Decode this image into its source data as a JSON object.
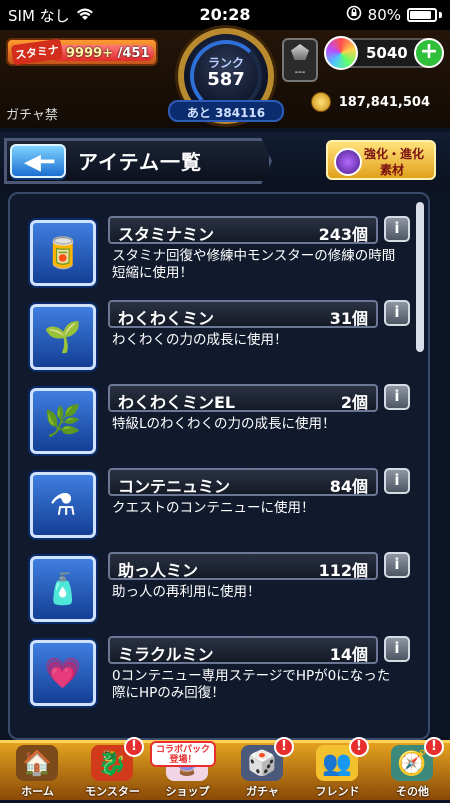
{
  "status": {
    "carrier": "SIM なし",
    "time": "20:28",
    "battery": "80%"
  },
  "header": {
    "stamina_label": "スタミナ",
    "stamina_current": "9999+",
    "stamina_max": "/451",
    "stamina_fill": 1.0,
    "rank_label": "ランク",
    "rank_value": "587",
    "rank_next": "あと 384116",
    "monster_slot": "---",
    "orb_count": "5040",
    "gacha_ban": "ガチャ禁",
    "gold": "187,841,504"
  },
  "title": {
    "text": "アイテム一覧",
    "evolve_line1": "強化・進化",
    "evolve_line2": "素材"
  },
  "items": [
    {
      "name": "スタミナミン",
      "count": "243個",
      "desc": "スタミナ回復や修練中モンスターの修練の時間短縮に使用！",
      "icon": "stamina-can-icon"
    },
    {
      "name": "わくわくミン",
      "count": "31個",
      "desc": "わくわくの力の成長に使用！",
      "icon": "sprout-bottle-icon"
    },
    {
      "name": "わくわくミンEL",
      "count": "2個",
      "desc": "特級Lのわくわくの力の成長に使用！",
      "icon": "sprout-bottle-el-icon"
    },
    {
      "name": "コンテニュミン",
      "count": "84個",
      "desc": "クエストのコンテニューに使用！",
      "icon": "continue-flask-icon"
    },
    {
      "name": "助っ人ミン",
      "count": "112個",
      "desc": "助っ人の再利用に使用！",
      "icon": "helper-bottle-icon"
    },
    {
      "name": "ミラクルミン",
      "count": "14個",
      "desc": "0コンテニュー専用ステージでHPが0になった際にHPのみ回復！",
      "icon": "miracle-heart-icon"
    }
  ],
  "tabbar": {
    "tabs": [
      {
        "label": "ホーム",
        "icon": "home-icon"
      },
      {
        "label": "モンスター",
        "icon": "monster-icon",
        "badge": "!"
      },
      {
        "label": "ショップ",
        "icon": "shop-orb-icon",
        "collab": "コラボパック登場！"
      },
      {
        "label": "ガチャ",
        "icon": "gacha-icon",
        "badge": "!"
      },
      {
        "label": "フレンド",
        "icon": "friend-icon",
        "badge": "!"
      },
      {
        "label": "その他",
        "icon": "other-icon",
        "badge": "!"
      }
    ]
  }
}
